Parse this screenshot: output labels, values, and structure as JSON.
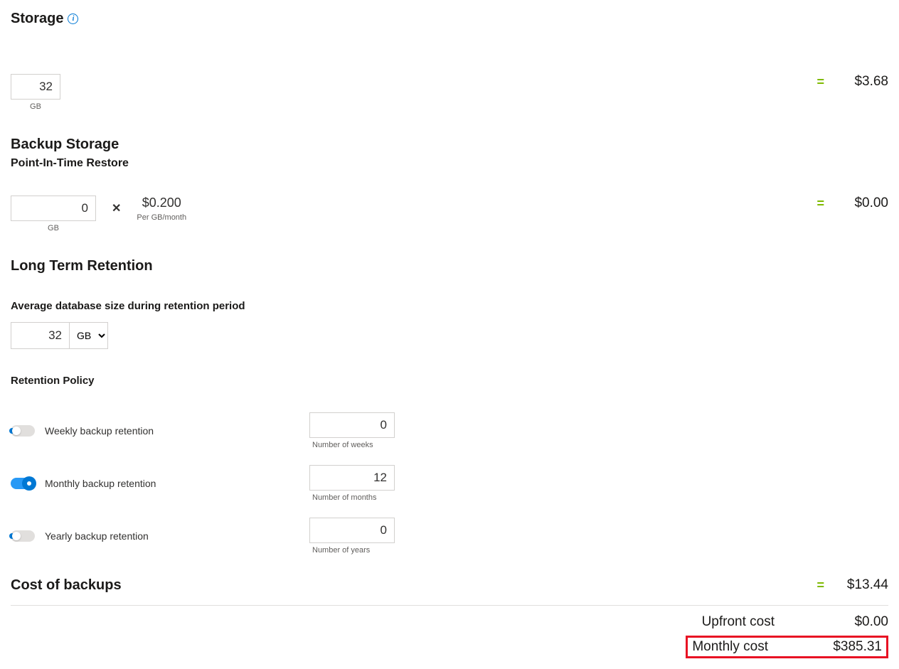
{
  "storage": {
    "heading": "Storage",
    "value": "32",
    "unit": "GB",
    "cost": "$3.68"
  },
  "backup": {
    "heading": "Backup Storage",
    "pitr_heading": "Point-In-Time Restore",
    "value": "0",
    "unit": "GB",
    "price": "$0.200",
    "price_unit": "Per GB/month",
    "cost": "$0.00"
  },
  "ltr": {
    "heading": "Long Term Retention",
    "avg_label": "Average database size during retention period",
    "avg_value": "32",
    "avg_unit": "GB",
    "policy_heading": "Retention Policy",
    "weekly": {
      "label": "Weekly backup retention",
      "value": "0",
      "unit": "Number of weeks",
      "on": false
    },
    "monthly": {
      "label": "Monthly backup retention",
      "value": "12",
      "unit": "Number of months",
      "on": true
    },
    "yearly": {
      "label": "Yearly backup retention",
      "value": "0",
      "unit": "Number of years",
      "on": false
    }
  },
  "cost_of_backups": {
    "heading": "Cost of backups",
    "cost": "$13.44"
  },
  "summary": {
    "upfront_label": "Upfront cost",
    "upfront_value": "$0.00",
    "monthly_label": "Monthly cost",
    "monthly_value": "$385.31"
  }
}
